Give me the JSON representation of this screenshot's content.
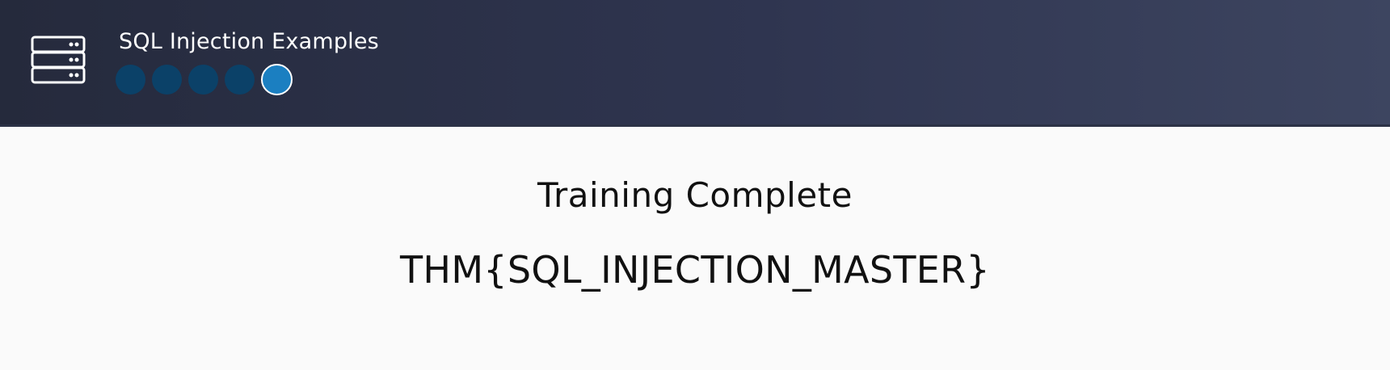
{
  "header": {
    "title": "SQL Injection Examples",
    "icon": "server-icon",
    "steps": [
      {
        "state": "completed"
      },
      {
        "state": "completed"
      },
      {
        "state": "completed"
      },
      {
        "state": "completed"
      },
      {
        "state": "current"
      }
    ],
    "colors": {
      "background_start": "#252a3c",
      "background_end": "#3d4560",
      "step_completed": "#0b4168",
      "step_current": "#1b7fc1"
    }
  },
  "main": {
    "heading": "Training Complete",
    "flag": "THM{SQL_INJECTION_MASTER}"
  }
}
